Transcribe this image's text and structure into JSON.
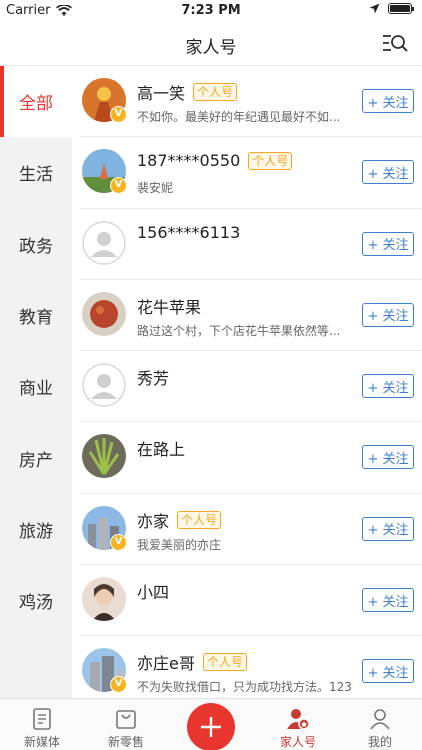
{
  "status_bar": {
    "carrier": "Carrier",
    "time": "7:23 PM"
  },
  "header": {
    "title": "家人号"
  },
  "categories": [
    {
      "label": "全部"
    },
    {
      "label": "生活"
    },
    {
      "label": "政务"
    },
    {
      "label": "教育"
    },
    {
      "label": "商业"
    },
    {
      "label": "房产"
    },
    {
      "label": "旅游"
    },
    {
      "label": "鸡汤"
    }
  ],
  "accounts": [
    {
      "name": "高一笑",
      "tag": "个人号",
      "desc": "不如你。最美好的年纪遇见最好不如...",
      "follow": "+ 关注"
    },
    {
      "name": "187****0550",
      "tag": "个人号",
      "desc": "裴安妮",
      "follow": "+ 关注"
    },
    {
      "name": "156****6113",
      "tag": "",
      "desc": "",
      "follow": "+ 关注"
    },
    {
      "name": "花牛苹果",
      "tag": "",
      "desc": "路过这个村，下个店花牛苹果依然等...",
      "follow": "+ 关注"
    },
    {
      "name": "秀芳",
      "tag": "",
      "desc": "",
      "follow": "+ 关注"
    },
    {
      "name": "在路上",
      "tag": "",
      "desc": "",
      "follow": "+ 关注"
    },
    {
      "name": "亦家",
      "tag": "个人号",
      "desc": "我爱美丽的亦庄",
      "follow": "+ 关注"
    },
    {
      "name": "小四",
      "tag": "",
      "desc": "",
      "follow": "+ 关注"
    },
    {
      "name": "亦庄e哥",
      "tag": "个人号",
      "desc": "不为失败找借口，只为成功找方法。123",
      "follow": "+ 关注"
    }
  ],
  "verified_badge": "V",
  "tabbar": {
    "items": [
      {
        "label": "新媒体"
      },
      {
        "label": "新零售"
      },
      {
        "label": "家人号"
      },
      {
        "label": "我的"
      }
    ]
  },
  "colors": {
    "accent": "#e8352d",
    "follow_blue": "#3d7fd1",
    "tag_orange": "#f5a623"
  }
}
